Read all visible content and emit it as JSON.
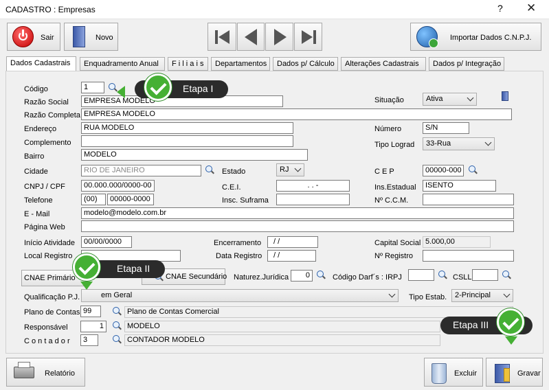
{
  "window": {
    "title": "CADASTRO : Empresas",
    "help": "?",
    "close": "✕"
  },
  "toolbar": {
    "sair": "Sair",
    "novo": "Novo",
    "import": "Importar Dados C.N.P.J."
  },
  "tabs": [
    "Dados Cadastrais",
    "Enquadramento Anual",
    "F i l i a i s",
    "Departamentos",
    "Dados p/ Cálculo",
    "Alterações Cadastrais",
    "Dados p/ Integração"
  ],
  "labels": {
    "codigo": "Código",
    "razao_social": "Razão Social",
    "razao_completa": "Razão Completa",
    "endereco": "Endereço",
    "complemento": "Complemento",
    "bairro": "Bairro",
    "cidade": "Cidade",
    "estado": "Estado",
    "cep": "C E P",
    "cnpj": "CNPJ / CPF",
    "cei": "C.E.I.",
    "ins_estadual": "Ins.Estadual",
    "telefone": "Telefone",
    "insc_suframa": "Insc. Suframa",
    "ccm": "Nº C.C.M.",
    "email": "E - Mail",
    "pagina_web": "Página Web",
    "inicio_atividade": "Início Atividade",
    "encerramento": "Encerramento",
    "capital_social": "Capital Social",
    "local_registro": "Local Registro",
    "data_registro": "Data Registro",
    "num_registro": "Nº Registro",
    "cnae_primario": "CNAE Primário",
    "cnae_secundario": "CNAE Secundário",
    "natureza": "Naturez.Jurídica",
    "darf": "Código Darf´s : IRPJ",
    "csll": "CSLL",
    "qualificacao": "Qualificação P.J.",
    "tipo_estab": "Tipo Estab.",
    "plano": "Plano de Contas",
    "responsavel": "Responsável",
    "contador": "C o n t a d o r",
    "situacao": "Situação",
    "numero": "Número",
    "tipo_lograd": "Tipo Lograd"
  },
  "values": {
    "codigo": "1",
    "razao_social": "EMPRESA MODELO",
    "razao_completa": "EMPRESA MODELO",
    "endereco": "RUA MODELO",
    "complemento": "",
    "bairro": "MODELO",
    "cidade": "RIO DE JANEIRO",
    "estado": "RJ",
    "cep": "00000-000",
    "cnpj": "00.000.000/0000-00",
    "cei": ".   .   -",
    "ins_estadual": "ISENTO",
    "tel_ddd": "(00)",
    "telefone": "00000-0000",
    "insc_suframa": "",
    "ccm": "",
    "email": "modelo@modelo.com.br",
    "pagina_web": "",
    "inicio_atividade": "00/00/0000",
    "encerramento": "/ /",
    "capital_social": "5.000,00",
    "local_registro": "",
    "data_registro": "/ /",
    "num_registro": "",
    "natureza": "0",
    "irpj": "",
    "csll": "",
    "qualificacao": "em Geral",
    "tipo_estab": "2-Principal",
    "plano_code": "99",
    "plano_desc": "Plano de Contas Comercial",
    "resp_code": "1",
    "resp_desc": "MODELO",
    "cont_code": "3",
    "cont_desc": "CONTADOR MODELO",
    "situacao": "Ativa",
    "numero": "S/N",
    "tipo_lograd": "33-Rua"
  },
  "callouts": {
    "etapa1": "Etapa I",
    "etapa2": "Etapa II",
    "etapa3": "Etapa III"
  },
  "footer": {
    "relatorio": "Relatório",
    "excluir": "Excluir",
    "gravar": "Gravar"
  }
}
